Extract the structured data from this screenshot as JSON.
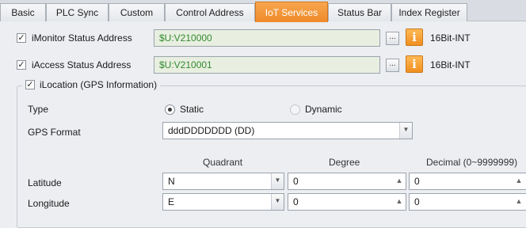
{
  "tabs": [
    {
      "label": "Basic"
    },
    {
      "label": "PLC Sync"
    },
    {
      "label": "Custom"
    },
    {
      "label": "Control Address"
    },
    {
      "label": "IoT Services"
    },
    {
      "label": "Status Bar"
    },
    {
      "label": "Index Register"
    }
  ],
  "active_tab": "IoT Services",
  "imonitor": {
    "label": "iMonitor Status Address",
    "checked": true,
    "value": "$U:V210000",
    "button": "...",
    "type": "16Bit-INT"
  },
  "iaccess": {
    "label": "iAccess Status Address",
    "checked": true,
    "value": "$U:V210001",
    "button": "...",
    "type": "16Bit-INT"
  },
  "ilocation": {
    "title": "iLocation (GPS Information)",
    "checked": true,
    "type_label": "Type",
    "type_options": [
      "Static",
      "Dynamic"
    ],
    "type_selected": "Static",
    "gps_format_label": "GPS Format",
    "gps_format_value": "dddDDDDDDD (DD)",
    "col_headers": [
      "Quadrant",
      "Degree",
      "Decimal (0~9999999)"
    ],
    "rows": [
      {
        "label": "Latitude",
        "quadrant": "N",
        "degree": "0",
        "decimal": "0"
      },
      {
        "label": "Longitude",
        "quadrant": "E",
        "degree": "0",
        "decimal": "0"
      }
    ]
  },
  "colors": {
    "accent": "#f0902c",
    "value_text": "#2f8a2f",
    "field_bg": "#e9efe0"
  }
}
